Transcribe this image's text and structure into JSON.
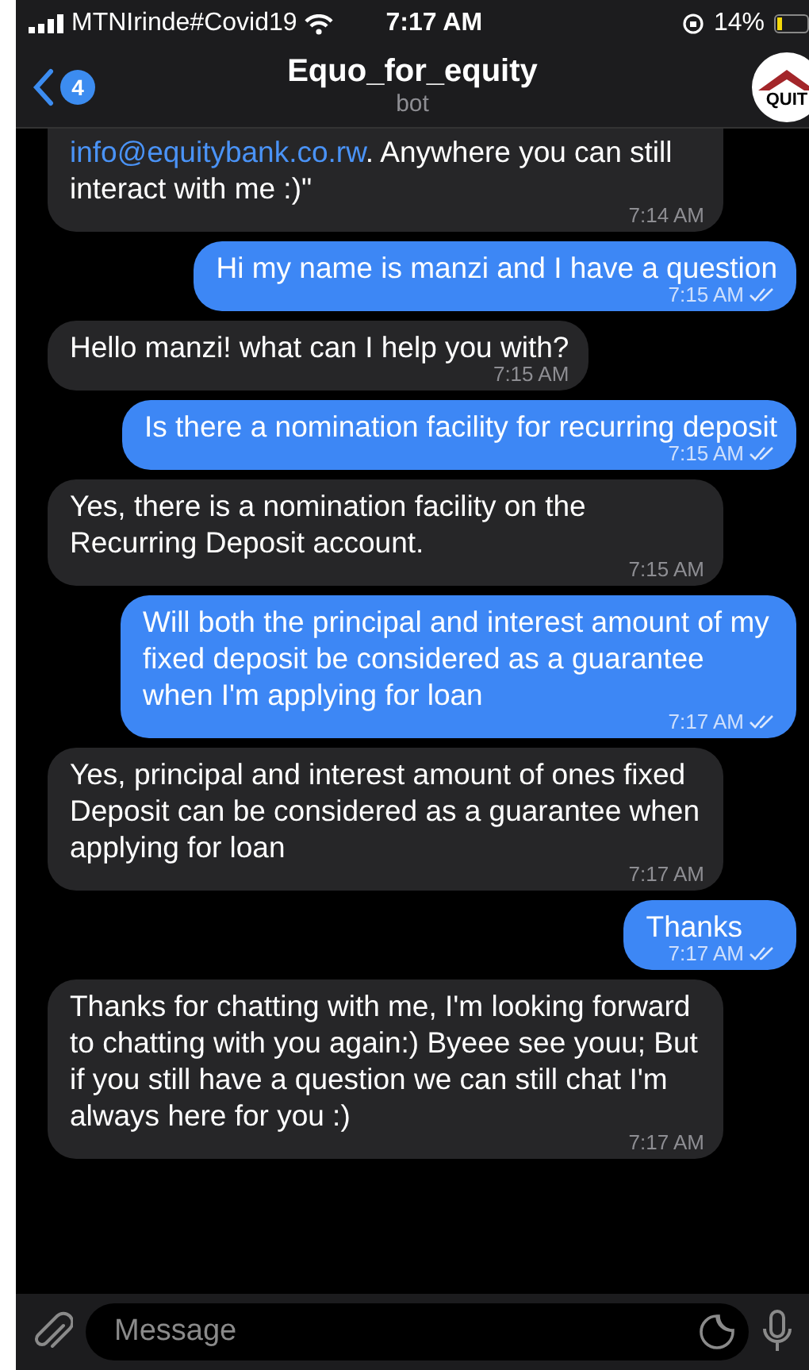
{
  "status_bar": {
    "carrier": "MTNIrinde#Covid19",
    "time": "7:17 AM",
    "battery": "14%"
  },
  "header": {
    "back_badge": "4",
    "title": "Equo_for_equity",
    "subtitle": "bot",
    "avatar_text": "QUIT"
  },
  "messages": [
    {
      "kind": "incoming",
      "parts": [
        {
          "kind": "link",
          "text": "info@equitybank.co.rw"
        },
        {
          "kind": "text",
          "text": ". Anywhere you can still interact with me :)\""
        }
      ],
      "time": "7:14 AM"
    },
    {
      "kind": "outgoing",
      "parts": [
        {
          "kind": "text",
          "text": "Hi my name is manzi and I have a question"
        }
      ],
      "time": "7:15 AM",
      "read": true
    },
    {
      "kind": "incoming",
      "parts": [
        {
          "kind": "text",
          "text": "Hello manzi! what can I help you with?"
        }
      ],
      "time": "7:15 AM"
    },
    {
      "kind": "outgoing",
      "parts": [
        {
          "kind": "text",
          "text": "Is there a nomination facility for recurring deposit"
        }
      ],
      "time": "7:15 AM",
      "read": true
    },
    {
      "kind": "incoming",
      "parts": [
        {
          "kind": "text",
          "text": "Yes, there is a nomination facility on the Recurring Deposit account."
        }
      ],
      "time": "7:15 AM"
    },
    {
      "kind": "outgoing",
      "parts": [
        {
          "kind": "text",
          "text": "Will both the principal and interest amount of my fixed deposit be considered as a guarantee when I'm applying for loan"
        }
      ],
      "time": "7:17 AM",
      "read": true
    },
    {
      "kind": "incoming",
      "parts": [
        {
          "kind": "text",
          "text": "Yes, principal and interest amount of ones fixed Deposit can be considered as a guarantee when applying for loan"
        }
      ],
      "time": "7:17 AM"
    },
    {
      "kind": "outgoing",
      "parts": [
        {
          "kind": "text",
          "text": "Thanks"
        }
      ],
      "time": "7:17 AM",
      "read": true
    },
    {
      "kind": "incoming",
      "parts": [
        {
          "kind": "text",
          "text": "Thanks for chatting with me, I'm looking forward to chatting with you again:) Byeee see youu; But if you still have a question we can still chat I'm always here for you :)"
        }
      ],
      "time": "7:17 AM"
    }
  ],
  "composer": {
    "placeholder": "Message"
  }
}
